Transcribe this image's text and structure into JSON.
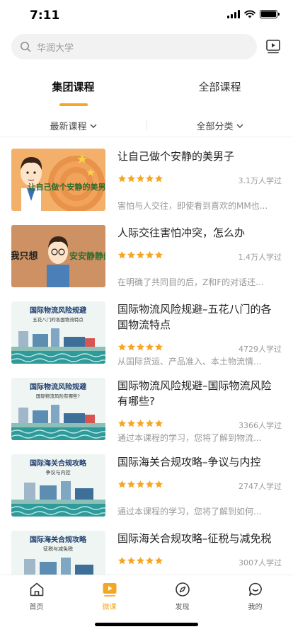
{
  "status_bar": {
    "time": "7:11"
  },
  "search": {
    "placeholder": "华润大学"
  },
  "tabs": [
    {
      "label": "集团课程",
      "active": true
    },
    {
      "label": "全部课程",
      "active": false
    }
  ],
  "filters": {
    "sort": "最新课程",
    "category": "全部分类"
  },
  "colors": {
    "accent": "#f5a623",
    "star": "#f5a623"
  },
  "courses": [
    {
      "title": "让自己做个安静的美男子",
      "thumb_text": "让自己做个安静的美男子",
      "rating": 5,
      "learners": "3.1万人学过",
      "desc": "害怕与人交往，即使看到喜欢的MM也..."
    },
    {
      "title": "人际交往害怕冲突，怎么办",
      "thumb_text_left": "我只想",
      "thumb_text_right": "安安静静的",
      "rating": 5,
      "learners": "1.4万人学过",
      "desc": "在明确了共同目的后，Z和F的对话还..."
    },
    {
      "title": "国际物流风险规避–五花八门的各国物流特点",
      "thumb_title": "国际物流风险规避",
      "thumb_subtitle": "五花八门的各国物流特点",
      "rating": 5,
      "learners": "4729人学过",
      "desc": "从国际货运、产品准入、本土物流情..."
    },
    {
      "title": "国际物流风险规避–国际物流风险有哪些?",
      "thumb_title": "国际物流风险规避",
      "thumb_subtitle": "国际物流风险有哪些?",
      "rating": 5,
      "learners": "3366人学过",
      "desc": "通过本课程的学习，您将了解到物流..."
    },
    {
      "title": "国际海关合规攻略–争议与内控",
      "thumb_title": "国际海关合规攻略",
      "thumb_subtitle": "争议与内控",
      "rating": 5,
      "learners": "2747人学过",
      "desc": "通过本课程的学习，您将了解到如何..."
    },
    {
      "title": "国际海关合规攻略–征税与减免税",
      "thumb_title": "国际海关合规攻略",
      "thumb_subtitle": "征税与减免税",
      "rating": 5,
      "learners": "3007人学过",
      "desc": ""
    }
  ],
  "tabbar": [
    {
      "label": "首页",
      "icon": "home-icon",
      "active": false
    },
    {
      "label": "微课",
      "icon": "micro-course-icon",
      "active": true
    },
    {
      "label": "发现",
      "icon": "discover-compass-icon",
      "active": false
    },
    {
      "label": "我的",
      "icon": "profile-chat-icon",
      "active": false
    }
  ]
}
